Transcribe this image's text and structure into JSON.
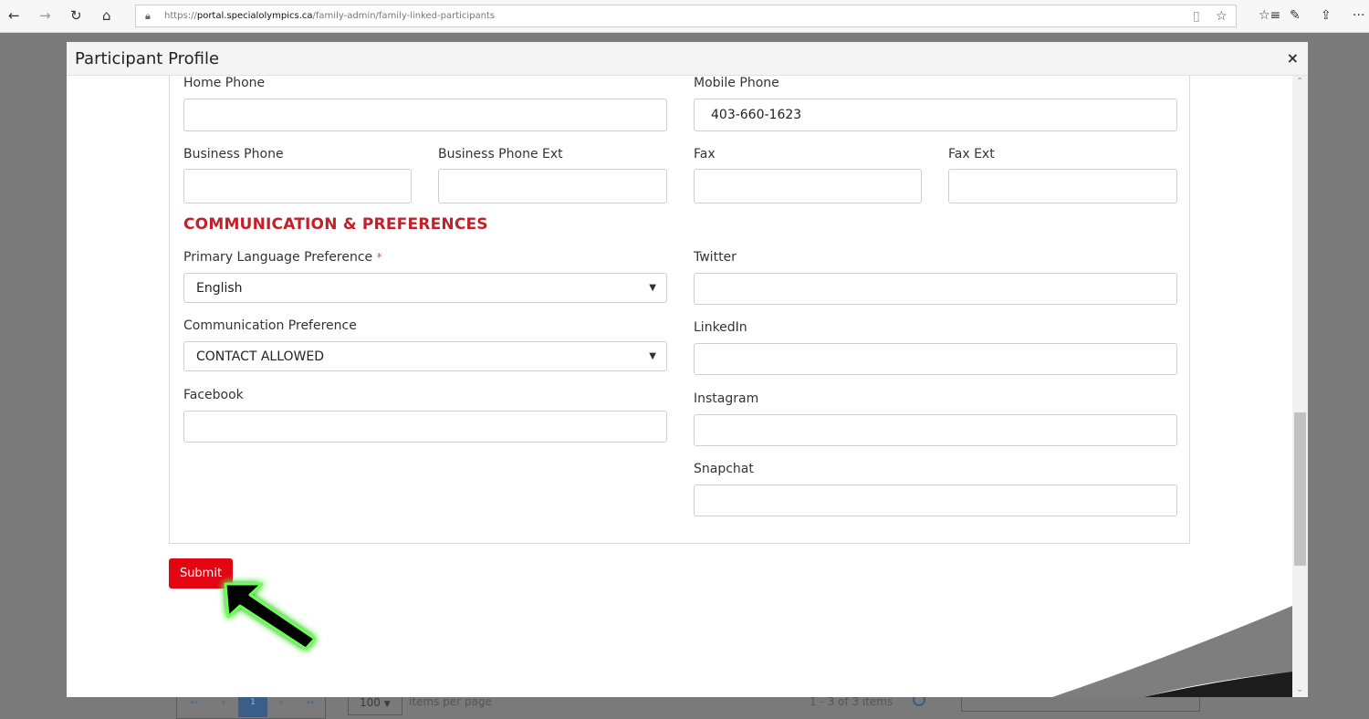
{
  "browser": {
    "back_icon": "←",
    "forward_icon": "→",
    "refresh_icon": "↻",
    "home_icon": "⌂",
    "url_prefix": "https://",
    "url_host": "portal.specialolympics.ca",
    "url_path": "/family-admin/family-linked-participants",
    "reading_icon": "▯",
    "favorite_icon": "☆",
    "favorites_list_icon": "☆≡",
    "notes_icon": "✎",
    "share_icon": "⇪",
    "more_icon": "···"
  },
  "background_grid": {
    "pager_buttons": [
      "◂◂",
      "◂",
      "1",
      "▸",
      "▸▸"
    ],
    "page_size": "100",
    "page_size_caret": "▼",
    "items_per_page": "items per page",
    "range_text": "1 - 3 of 3 items"
  },
  "modal": {
    "title": "Participant Profile",
    "close_icon": "×",
    "fields": {
      "home_phone": {
        "label": "Home Phone",
        "value": ""
      },
      "mobile_phone": {
        "label": "Mobile Phone",
        "value": "403-660-1623"
      },
      "business_phone": {
        "label": "Business Phone",
        "value": ""
      },
      "business_phone_ext": {
        "label": "Business Phone Ext",
        "value": ""
      },
      "fax": {
        "label": "Fax",
        "value": ""
      },
      "fax_ext": {
        "label": "Fax Ext",
        "value": ""
      },
      "primary_language": {
        "label": "Primary Language Preference",
        "required_mark": "*",
        "value": "English"
      },
      "communication_preference": {
        "label": "Communication Preference",
        "value": "CONTACT ALLOWED"
      },
      "facebook": {
        "label": "Facebook",
        "value": ""
      },
      "twitter": {
        "label": "Twitter",
        "value": ""
      },
      "linkedin": {
        "label": "LinkedIn",
        "value": ""
      },
      "instagram": {
        "label": "Instagram",
        "value": ""
      },
      "snapchat": {
        "label": "Snapchat",
        "value": ""
      }
    },
    "section_title": "COMMUNICATION & PREFERENCES",
    "submit_label": "Submit",
    "caret": "▼",
    "scroll_up": "⌃",
    "scroll_down": "⌄"
  },
  "colors": {
    "accent_red": "#c3202a",
    "submit_red": "#e10612",
    "arrow_glow": "#6dfc5a"
  }
}
